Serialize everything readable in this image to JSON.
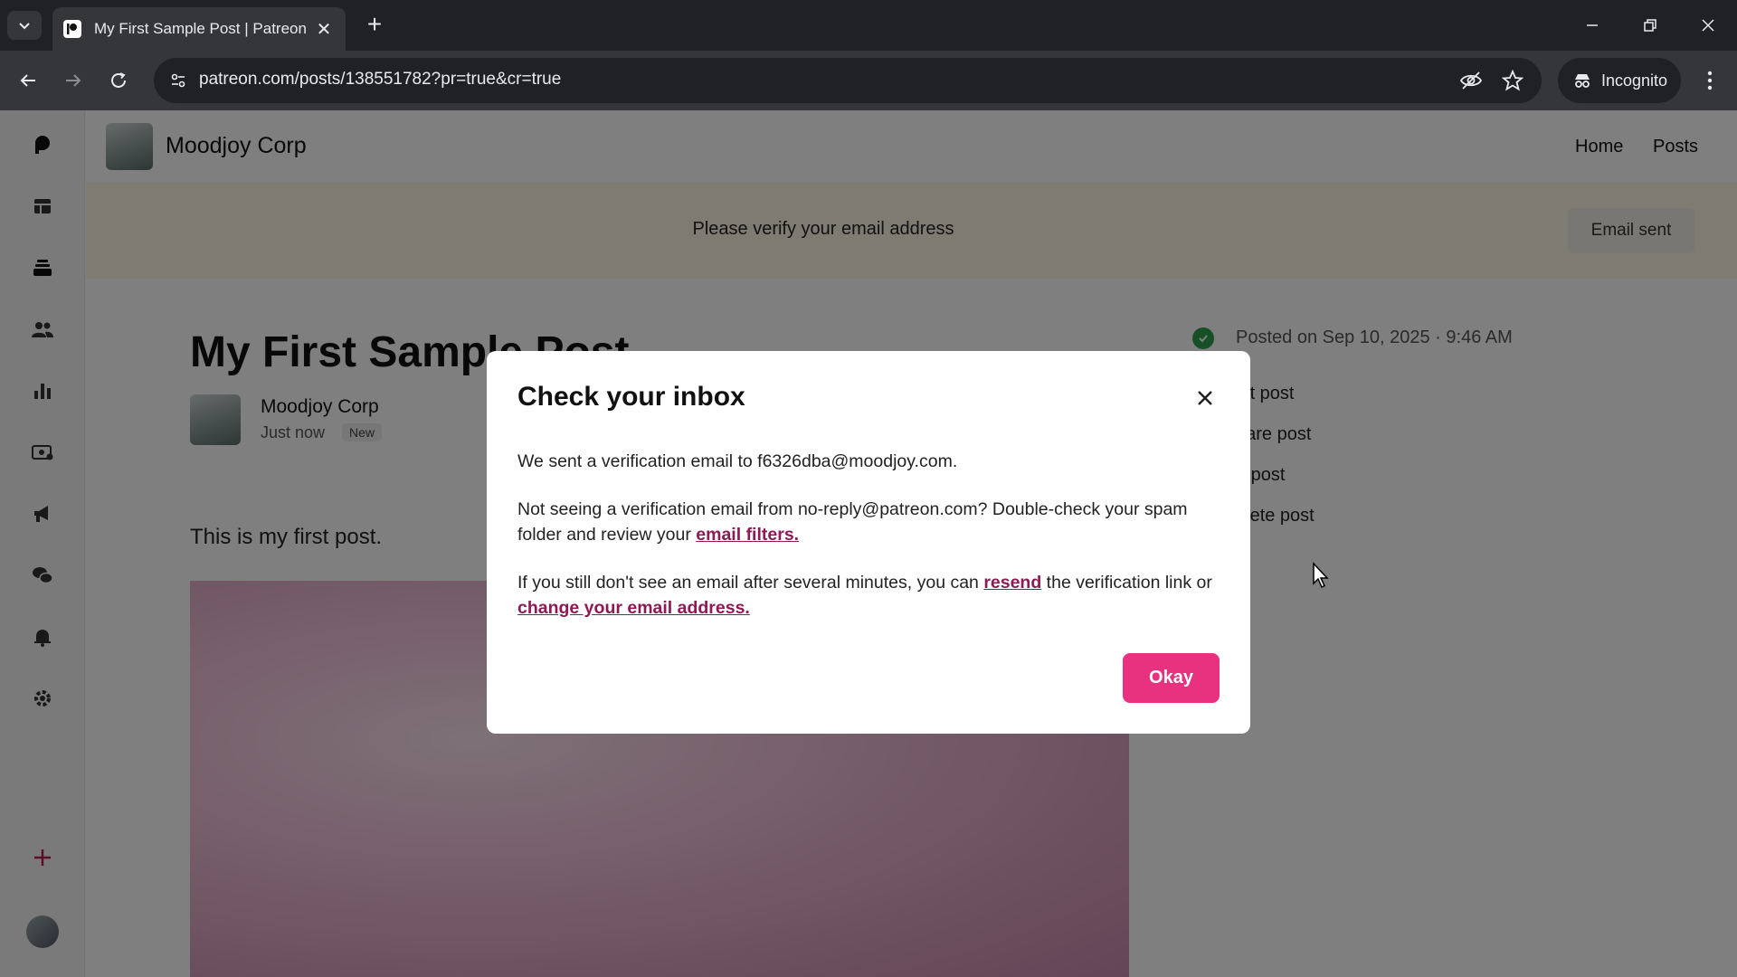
{
  "browser": {
    "tab_title": "My First Sample Post | Patreon",
    "url": "patreon.com/posts/138551782?pr=true&cr=true",
    "incognito_label": "Incognito"
  },
  "leftnav": {
    "icons": [
      "patreon-logo-icon",
      "dashboard-icon",
      "library-icon",
      "audience-icon",
      "insights-icon",
      "payouts-icon",
      "promotions-icon",
      "chats-icon",
      "notifications-icon",
      "settings-icon",
      "plus-icon"
    ]
  },
  "header": {
    "creator_name": "Moodjoy Corp",
    "nav": {
      "home": "Home",
      "posts": "Posts"
    }
  },
  "banner": {
    "text": "Please verify your email address",
    "button": "Email sent"
  },
  "post": {
    "title": "My First Sample Post",
    "author": "Moodjoy Corp",
    "time": "Just now",
    "badge": "New",
    "body": "This is my first post.",
    "posted_on": "Posted on Sep 10, 2025 · 9:46 AM",
    "actions": [
      "dit post",
      "hare post",
      "n post",
      "elete post"
    ]
  },
  "modal": {
    "title": "Check your inbox",
    "p1": "We sent a verification email to f6326dba@moodjoy.com.",
    "p2_before": "Not seeing a verification email from no-reply@patreon.com? Double-check your spam folder and review your ",
    "p2_link": "email filters.",
    "p3_before": "If you still don't see an email after several minutes, you can ",
    "p3_link1": "resend",
    "p3_middle": " the verification link or ",
    "p3_link2": "change your email address.",
    "okay": "Okay"
  },
  "colors": {
    "accent": "#e8317f",
    "link": "#8c1a55",
    "banner_bg": "#fdf6e6",
    "success": "#2e9e4f"
  }
}
